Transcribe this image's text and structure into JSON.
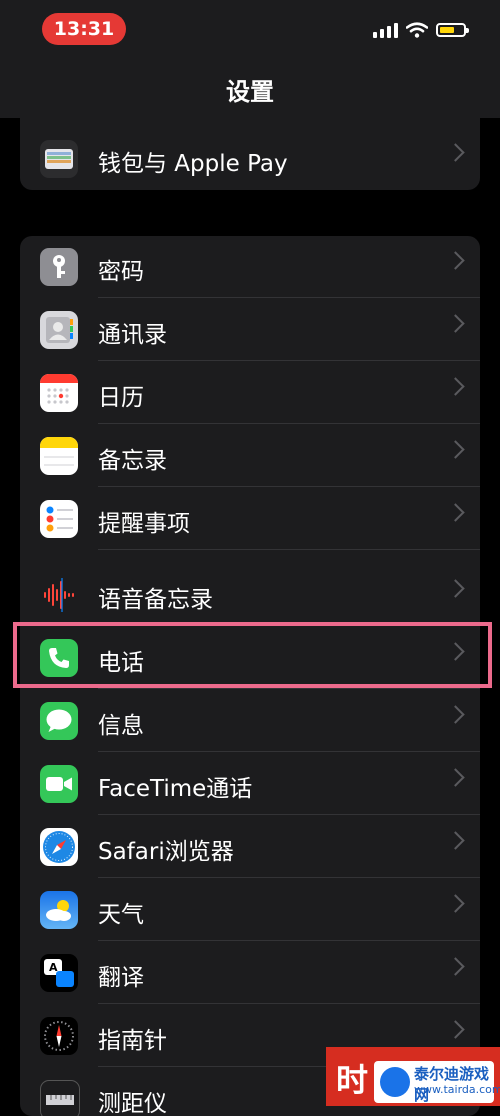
{
  "status_bar": {
    "time": "13:31"
  },
  "nav": {
    "title": "设置"
  },
  "wallet": {
    "label": "钱包与 Apple Pay"
  },
  "settings": [
    {
      "id": "passwords",
      "label": "密码"
    },
    {
      "id": "contacts",
      "label": "通讯录"
    },
    {
      "id": "calendar",
      "label": "日历"
    },
    {
      "id": "notes",
      "label": "备忘录"
    },
    {
      "id": "reminders",
      "label": "提醒事项"
    },
    {
      "id": "voice-memos",
      "label": "语音备忘录"
    },
    {
      "id": "phone",
      "label": "电话"
    },
    {
      "id": "messages",
      "label": "信息"
    },
    {
      "id": "facetime",
      "label": "FaceTime通话"
    },
    {
      "id": "safari",
      "label": "Safari浏览器"
    },
    {
      "id": "weather",
      "label": "天气"
    },
    {
      "id": "translate",
      "label": "翻译"
    },
    {
      "id": "compass",
      "label": "指南针"
    },
    {
      "id": "measure",
      "label": "测距仪"
    }
  ],
  "watermark": {
    "text": "时",
    "site_name": "泰尔迪游戏网",
    "site_url": "www.tairda.com"
  },
  "colors": {
    "highlight": "#ec6a8c",
    "time_pill": "#e53935",
    "phone_green": "#34c759"
  }
}
